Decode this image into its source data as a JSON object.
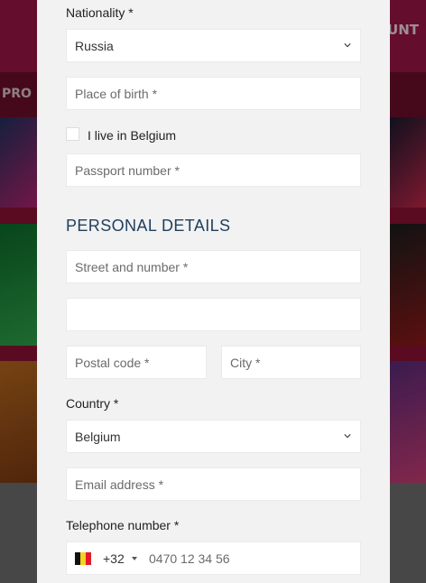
{
  "background": {
    "header_button": "UNT",
    "nav_item": "PRO"
  },
  "form": {
    "nationality": {
      "label": "Nationality *",
      "value": "Russia"
    },
    "place_of_birth": {
      "placeholder": "Place of birth *"
    },
    "live_in_belgium": {
      "label": "I live in Belgium",
      "checked": false
    },
    "passport": {
      "placeholder": "Passport number *"
    },
    "personal_details": {
      "title": "PERSONAL DETAILS",
      "street": {
        "placeholder": "Street and number *"
      },
      "address_line2": {
        "placeholder": ""
      },
      "postal_code": {
        "placeholder": "Postal code *"
      },
      "city": {
        "placeholder": "City *"
      },
      "country": {
        "label": "Country *",
        "value": "Belgium"
      },
      "email": {
        "placeholder": "Email address *"
      },
      "telephone": {
        "label": "Telephone number *",
        "flag": "belgium-flag-icon",
        "dial_code": "+32",
        "placeholder": "0470 12 34 56"
      }
    }
  },
  "colors": {
    "modal_bg": "#f2f2f2",
    "section_title": "#1d3f5e",
    "flag_black": "#111111",
    "flag_yellow": "#f5d21f",
    "flag_red": "#e21a2b"
  }
}
